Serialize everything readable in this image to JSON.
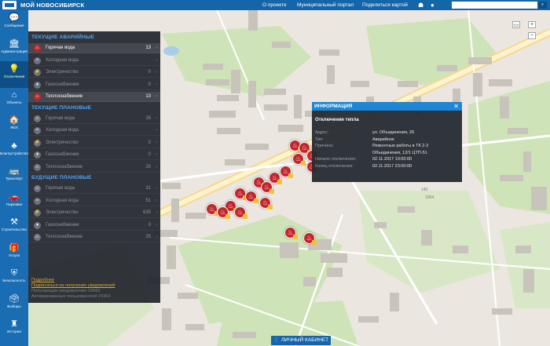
{
  "header": {
    "app_title": "МОЙ НОВОСИБИРСК",
    "links": [
      "О проекте",
      "Муниципальный портал",
      "Поделиться картой"
    ],
    "search_placeholder": "",
    "android_icon": "android-icon",
    "apple_icon": "apple-icon"
  },
  "sidebar": {
    "items": [
      {
        "label": "Сообщения",
        "icon": "message-icon",
        "glyph": "💬"
      },
      {
        "label": "Администрация",
        "icon": "building-icon",
        "glyph": "🏛"
      },
      {
        "label": "Отключения",
        "icon": "bulb-icon",
        "glyph": "💡"
      },
      {
        "label": "Объекты",
        "icon": "home-icon",
        "glyph": "⌂"
      },
      {
        "label": "ЖКХ",
        "icon": "house-icon",
        "glyph": "🏠"
      },
      {
        "label": "Благоустройство",
        "icon": "tree-icon",
        "glyph": "♣"
      },
      {
        "label": "Транспорт",
        "icon": "bus-icon",
        "glyph": "🚌"
      },
      {
        "label": "Парковки",
        "icon": "car-icon",
        "glyph": "🚗"
      },
      {
        "label": "Строительство",
        "icon": "crane-icon",
        "glyph": "⚒"
      },
      {
        "label": "Услуги",
        "icon": "gift-icon",
        "glyph": "🎁"
      },
      {
        "label": "Безопасность",
        "icon": "shield-icon",
        "glyph": "⛨"
      },
      {
        "label": "Выборы",
        "icon": "ballot-icon",
        "glyph": "🗳"
      },
      {
        "label": "История",
        "icon": "monument-icon",
        "glyph": "♜"
      }
    ]
  },
  "panel": {
    "sections": [
      {
        "title": "ТЕКУЩИЕ АВАРИЙНЫЕ",
        "rows": [
          {
            "label": "Горячая вода",
            "count": "13",
            "active": true
          },
          {
            "label": "Холодная вода",
            "count": "",
            "active": false
          },
          {
            "label": "Электричество",
            "count": "0",
            "active": false
          },
          {
            "label": "Газоснабжение",
            "count": "0",
            "active": false
          },
          {
            "label": "Теплоснабжение",
            "count": "13",
            "active": true
          }
        ]
      },
      {
        "title": "ТЕКУЩИЕ ПЛАНОВЫЕ",
        "rows": [
          {
            "label": "Горячая вода",
            "count": "26",
            "active": false
          },
          {
            "label": "Холодная вода",
            "count": "",
            "active": false
          },
          {
            "label": "Электричество",
            "count": "0",
            "active": false
          },
          {
            "label": "Газоснабжение",
            "count": "0",
            "active": false
          },
          {
            "label": "Теплоснабжение",
            "count": "26",
            "active": false
          }
        ]
      },
      {
        "title": "БУДУЩИЕ ПЛАНОВЫЕ",
        "rows": [
          {
            "label": "Горячая вода",
            "count": "31",
            "active": false
          },
          {
            "label": "Холодная вода",
            "count": "51",
            "active": false
          },
          {
            "label": "Электричество",
            "count": "635",
            "active": false
          },
          {
            "label": "Газоснабжение",
            "count": "0",
            "active": false
          },
          {
            "label": "Теплоснабжение",
            "count": "25",
            "active": false
          }
        ]
      }
    ],
    "more_link": "Подробнее",
    "subscribe_link": "Подписаться на получение уведомлений",
    "stat_notifications": "Получающих уведомления 10943",
    "stat_users": "Активированных пользователей 23363"
  },
  "popup": {
    "header": "ИНФОРМАЦИЯ",
    "close": "✕",
    "title": "Отключение тепла",
    "fields": [
      {
        "key": "Адрес:",
        "value": "ул. Объединения, 26"
      },
      {
        "key": "Тип:",
        "value": "Аварийное"
      },
      {
        "key": "Причина:",
        "value": "Ремонтные работы в ТК 2-3"
      },
      {
        "key": "",
        "value": "Объединения, 12/1 ЦТП-51"
      },
      {
        "key": "Начало отключения:",
        "value": "02.11.2017 19:00:00"
      },
      {
        "key": "Конец отключения:",
        "value": "02.11.2017 23:00:00"
      }
    ]
  },
  "footer": {
    "cabinet_label": "ЛИЧНЫЙ КАБИНЕТ"
  },
  "map_labels": {
    "label_1": "140",
    "label_2": "1004"
  },
  "colors": {
    "brand": "#1565a9",
    "accent": "#1d87d6",
    "alert": "#c3262a",
    "panel": "#22262e"
  }
}
